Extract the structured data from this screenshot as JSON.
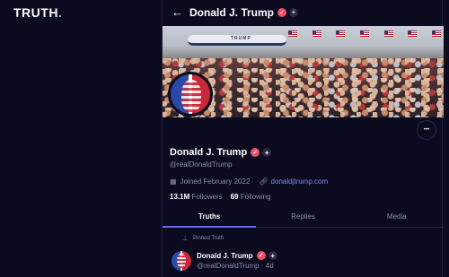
{
  "brand": {
    "logo": "TRUTH",
    "logo_dot": "."
  },
  "header": {
    "back_icon": "arrow-left-icon",
    "name": "Donald J. Trump"
  },
  "banner": {
    "plane_text": "TRUMP"
  },
  "profile": {
    "name": "Donald J. Trump",
    "handle": "@realDonaldTrump",
    "joined": "Joined February 2022",
    "website": "donaldjtrump.com",
    "followers_count": "13.1M",
    "followers_label": "Followers",
    "following_count": "69",
    "following_label": "Following",
    "more_label": "•••"
  },
  "tabs": [
    {
      "label": "Truths",
      "active": true
    },
    {
      "label": "Replies",
      "active": false
    },
    {
      "label": "Media",
      "active": false
    }
  ],
  "pinned": {
    "label": "Pinned Truth"
  },
  "post": {
    "name": "Donald J. Trump",
    "handle_time": "@realDonaldTrump · 4d"
  },
  "colors": {
    "background": "#0c0a1e",
    "accent": "#5d6bff",
    "verified": "#ea4f65",
    "link": "#6f8cff",
    "muted": "#8e8ba6"
  }
}
